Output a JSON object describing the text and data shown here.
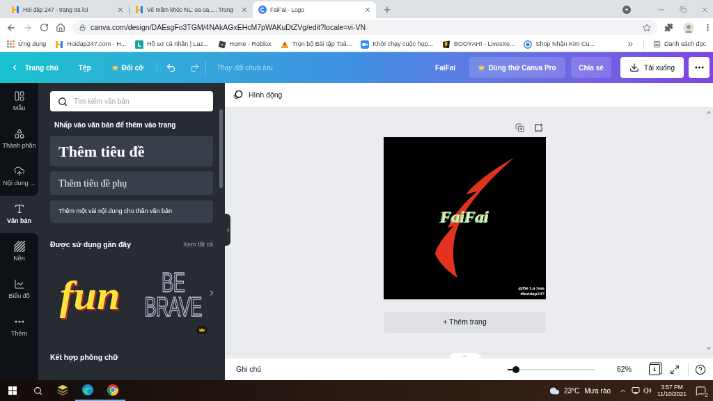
{
  "browser": {
    "tabs": [
      {
        "title": "Hỏi đáp 247 - trang tra loi",
        "selected": false
      },
      {
        "title": "Vẽ mầm khóc NL: oa oa..... Trong",
        "selected": false
      },
      {
        "title": "FaiFai - Logo",
        "selected": true
      }
    ],
    "address": "canva.com/design/DAEsgFo3TGM/4NAkAGxEHcM7pWAKuDtZVg/edit?locale=vi-VN",
    "bookmarks": [
      "Ứng dụng",
      "Hoidap247.com - H...",
      "Hồ sơ cá nhân | Laz...",
      "Home - Roblox",
      "Trọn bộ Bài tập Toá...",
      "Khởi chạy cuộc họp...",
      "BOOYAH! - Livestre...",
      "Shop Nhận Kim Cu..."
    ],
    "reading_list": "Danh sách đọc"
  },
  "toolbar": {
    "home": "Trang chủ",
    "file": "Tệp",
    "resize": "Đổi cỡ",
    "save_status": "Thay đổi chưa lưu",
    "design_title": "FaiFai",
    "try_pro": "Dùng thử Canva Pro",
    "share": "Chia sẻ",
    "download": "Tải xuống"
  },
  "rail": [
    {
      "label": "Mẫu",
      "selected": false
    },
    {
      "label": "Thành phần",
      "selected": false
    },
    {
      "label": "Nội dung ...",
      "selected": false
    },
    {
      "label": "Văn bản",
      "selected": true
    },
    {
      "label": "Nền",
      "selected": false
    },
    {
      "label": "Biểu đồ",
      "selected": false
    },
    {
      "label": "Thêm",
      "selected": false
    }
  ],
  "text_panel": {
    "search": {
      "placeholder": "Tìm kiếm văn bản"
    },
    "hint": "Nhấp vào văn bản để thêm vào trang",
    "presets": [
      {
        "kind": "heading",
        "label": "Thêm tiêu đề"
      },
      {
        "kind": "subheading",
        "label": "Thêm tiêu đề phụ"
      },
      {
        "kind": "body",
        "label": "Thêm một vài nội dung cho thân văn bản"
      }
    ],
    "recent": {
      "title": "Được sử dụng gần đây",
      "see_all": "Xem tất cả",
      "styles": [
        {
          "kind": "filled",
          "lines": [
            "fun"
          ],
          "pro": false
        },
        {
          "kind": "outline",
          "lines": [
            "BE",
            "BRAVE"
          ],
          "pro": true
        }
      ]
    },
    "combos_title": "Kết hợp phông chữ"
  },
  "editor": {
    "animate": "Hình động",
    "design": {
      "title": "FaiFai",
      "credits": [
        "@Bé Là Sun",
        "#hoidap247"
      ]
    },
    "add_page": "+ Thêm trang",
    "notes": "Ghi chú",
    "zoom": {
      "level": 0.1,
      "reading": "62%"
    },
    "page_count": "1"
  },
  "taskbar": {
    "apps": [
      {
        "running": false
      },
      {
        "running": true
      },
      {
        "running": true
      }
    ],
    "temperature": "23°C",
    "weather": "Mưa rào",
    "time": "3:57 PM",
    "date": "11/10/2021",
    "notifications": "2"
  }
}
